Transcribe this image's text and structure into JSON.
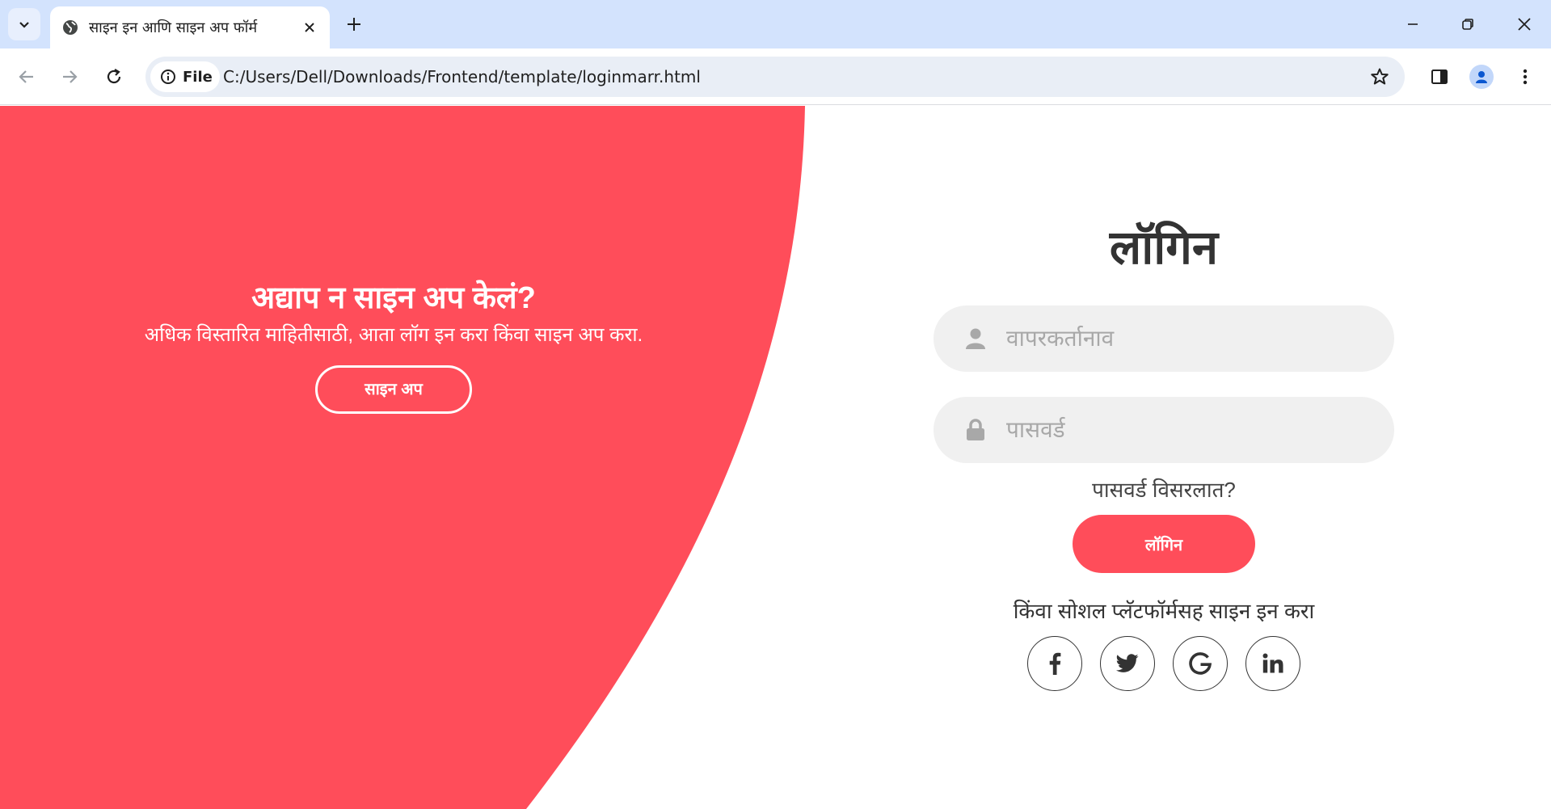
{
  "browser": {
    "tab_title": "साइन इन आणि साइन अप फॉर्म",
    "address_chip_label": "File",
    "url": "C:/Users/Dell/Downloads/Frontend/template/loginmarr.html"
  },
  "colors": {
    "accent": "#ff4d5a",
    "chrome_tabbar": "#d3e3fd",
    "omnibox": "#e9eef6",
    "input_bg": "#f0f0f0"
  },
  "left_panel": {
    "title": "अद्याप न साइन अप केलं?",
    "subtitle": "अधिक विस्तारित माहितीसाठी, आता लॉग इन करा किंवा साइन अप करा.",
    "signup_button": "साइन अप"
  },
  "login_form": {
    "title": "लॉगिन",
    "username_placeholder": "वापरकर्तानाव",
    "password_placeholder": "पासवर्ड",
    "forgot_password": "पासवर्ड विसरलात?",
    "login_button": "लॉगिन",
    "social_text": "किंवा सोशल प्लॅटफॉर्मसह साइन इन करा",
    "social_icons": [
      "facebook-icon",
      "twitter-icon",
      "google-icon",
      "linkedin-icon"
    ]
  }
}
